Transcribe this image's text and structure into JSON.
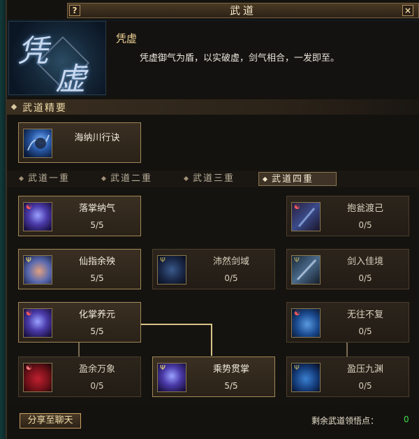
{
  "window": {
    "title": "武道",
    "help_label": "?",
    "close_label": "×"
  },
  "skill": {
    "name": "凭虚",
    "description": "凭虚御气为盾，以实破虚，剑气相合，一发即至。",
    "art_glyphs": [
      "凭",
      "虚"
    ]
  },
  "section": {
    "title": "武道精要"
  },
  "essential": {
    "name": "海纳川行诀",
    "icon": "blue-figure-icon"
  },
  "tabs": [
    {
      "label": "武道一重",
      "active": false
    },
    {
      "label": "武道二重",
      "active": false
    },
    {
      "label": "武道三重",
      "active": false
    },
    {
      "label": "武道四重",
      "active": true
    }
  ],
  "skills": [
    {
      "name": "落掌纳气",
      "level": "5/5",
      "icon": "palm-figure-icon",
      "tag": "taiji"
    },
    {
      "name": "抱瓮渡己",
      "level": "0/5",
      "icon": "sword-icon",
      "tag": "taiji"
    },
    {
      "name": "仙指余殃",
      "level": "5/5",
      "icon": "finger-icon",
      "tag": "trident"
    },
    {
      "name": "沛然剑域",
      "level": "0/5",
      "icon": "sword-field-icon",
      "tag": "trident"
    },
    {
      "name": "剑入佳境",
      "level": "0/5",
      "icon": "sword-icon",
      "tag": "trident"
    },
    {
      "name": "化掌养元",
      "level": "5/5",
      "icon": "palm-figure-icon",
      "tag": "taiji"
    },
    {
      "name": "无往不复",
      "level": "0/5",
      "icon": "blue-spirit-icon",
      "tag": "taiji"
    },
    {
      "name": "盈余万象",
      "level": "0/5",
      "icon": "red-aura-icon",
      "tag": "taiji"
    },
    {
      "name": "乘势贯掌",
      "level": "5/5",
      "icon": "palm-figure-icon",
      "tag": "trident"
    },
    {
      "name": "盈压九渊",
      "level": "0/5",
      "icon": "blue-spirit-icon",
      "tag": "trident"
    }
  ],
  "footer": {
    "share_label": "分享至聊天",
    "points_label": "剩余武道领悟点：",
    "points_value": "0"
  },
  "colors": {
    "accent": "#d8c48a",
    "points": "#3ee04a",
    "title": "#f2d596"
  }
}
